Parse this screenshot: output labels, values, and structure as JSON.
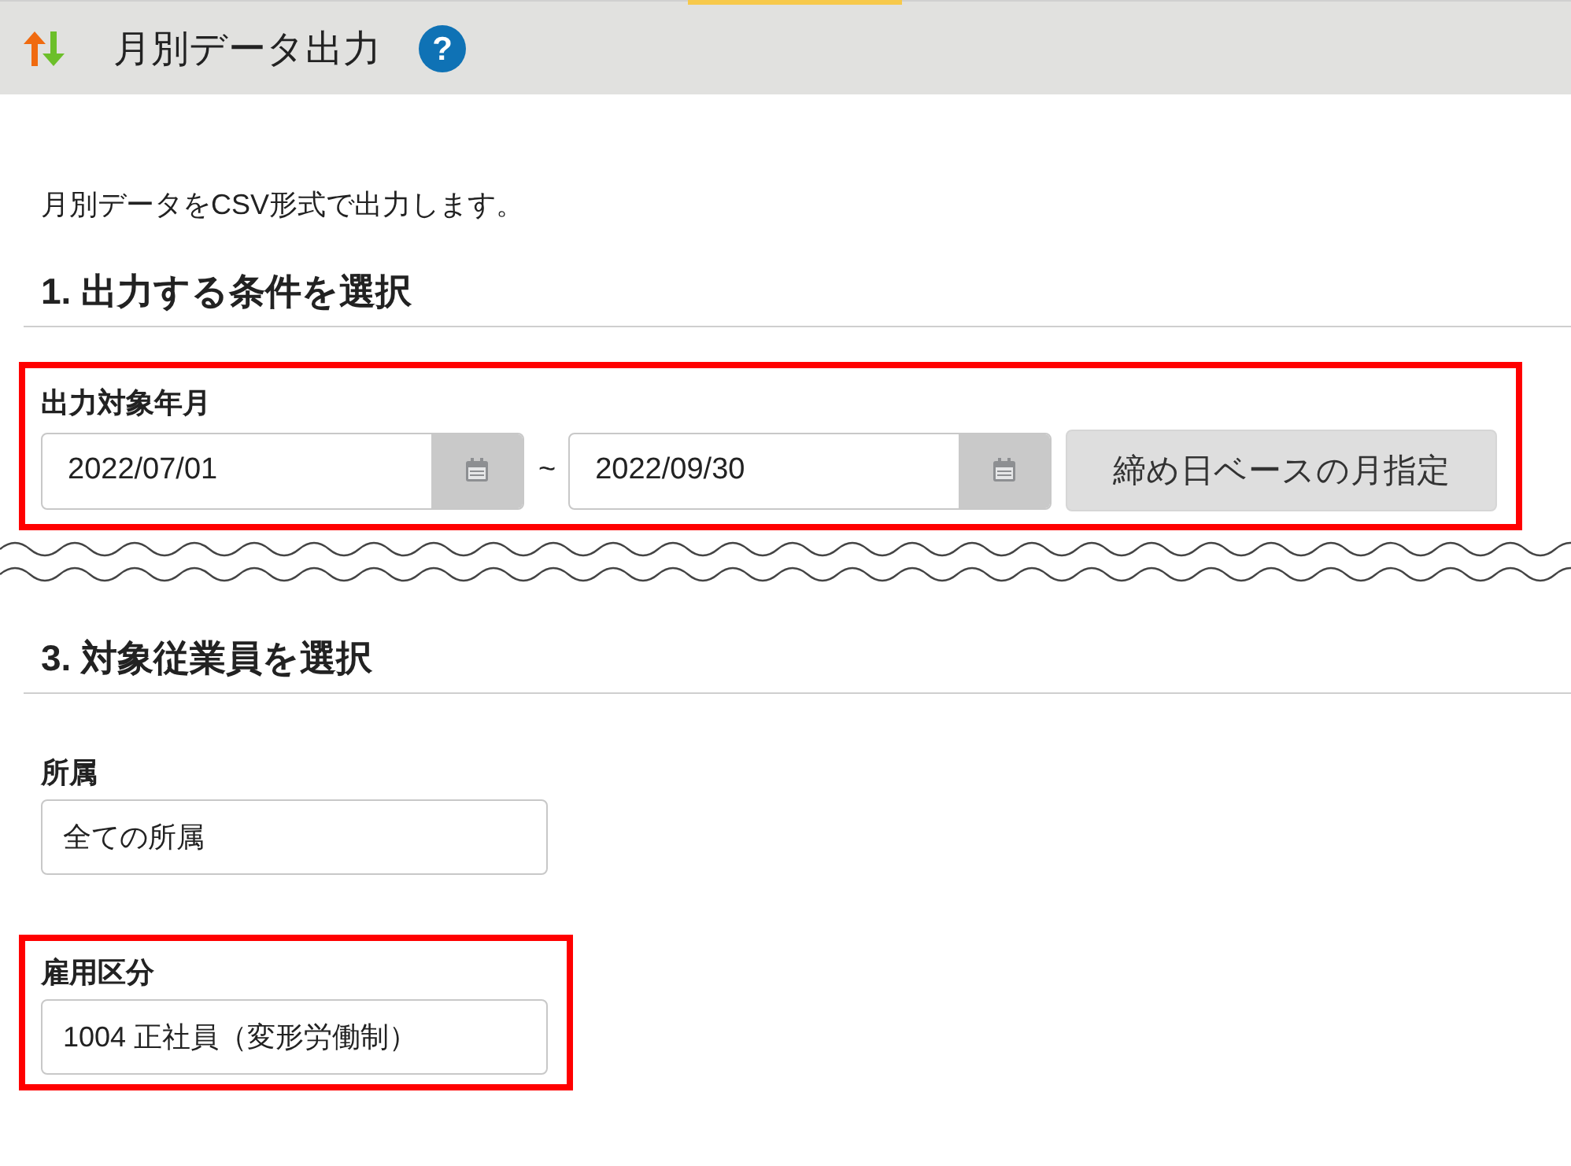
{
  "header": {
    "title": "月別データ出力",
    "help": "?"
  },
  "description": "月別データをCSV形式で出力します。",
  "content": [
    {
      "kind": "heading",
      "text": "1. 出力する条件を選択"
    },
    {
      "kind": "date_range",
      "label": "出力対象年月",
      "highlighted": true,
      "start": "2022/07/01",
      "separator": "~",
      "end": "2022/09/30",
      "button": "締め日ベースの月指定"
    },
    {
      "kind": "break"
    },
    {
      "kind": "heading",
      "text": "3. 対象従業員を選択"
    },
    {
      "kind": "select",
      "label": "所属",
      "value": "全ての所属",
      "highlighted": false
    },
    {
      "kind": "select",
      "label": "雇用区分",
      "value": "1004 正社員（変形労働制）",
      "highlighted": true
    }
  ]
}
